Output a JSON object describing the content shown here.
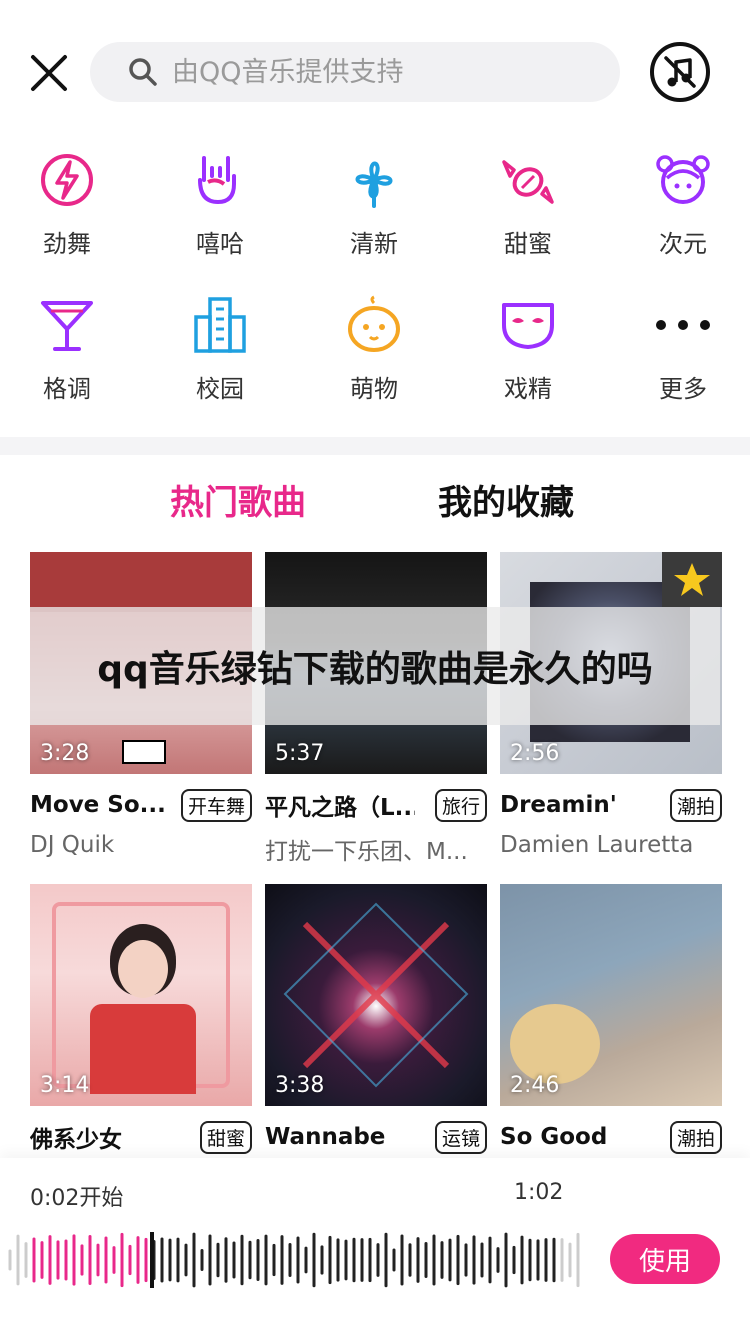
{
  "search": {
    "placeholder": "由QQ音乐提供支持"
  },
  "categories": [
    {
      "label": "劲舞",
      "icon": "lightning-icon"
    },
    {
      "label": "嘻哈",
      "icon": "rock-hand-icon"
    },
    {
      "label": "清新",
      "icon": "clover-icon"
    },
    {
      "label": "甜蜜",
      "icon": "candy-icon"
    },
    {
      "label": "次元",
      "icon": "anime-girl-icon"
    },
    {
      "label": "格调",
      "icon": "cocktail-icon"
    },
    {
      "label": "校园",
      "icon": "school-building-icon"
    },
    {
      "label": "萌物",
      "icon": "cute-face-icon"
    },
    {
      "label": "戏精",
      "icon": "mask-icon"
    },
    {
      "label": "更多",
      "icon": "more-dots-icon"
    }
  ],
  "tabs": {
    "hot": "热门歌曲",
    "favorites": "我的收藏"
  },
  "banner": {
    "text": "qq音乐绿钻下载的歌曲是永久的吗"
  },
  "songs": [
    {
      "title": "Move So...",
      "tag": "开车舞",
      "artist": "DJ Quik",
      "duration": "3:28"
    },
    {
      "title": "平凡之路（L...",
      "tag": "旅行",
      "artist": "打扰一下乐团、M...",
      "duration": "5:37"
    },
    {
      "title": "Dreamin'",
      "tag": "潮拍",
      "artist": "Damien Lauretta",
      "duration": "2:56"
    },
    {
      "title": "佛系少女",
      "tag": "甜蜜",
      "artist": "",
      "duration": "3:14"
    },
    {
      "title": "Wannabe",
      "tag": "运镜",
      "artist": "",
      "duration": "3:38"
    },
    {
      "title": "So Good",
      "tag": "潮拍",
      "artist": "",
      "duration": "2:46"
    }
  ],
  "player": {
    "start_label": "0:02开始",
    "end_time": "1:02",
    "use_label": "使用"
  },
  "colors": {
    "accent": "#e8288a",
    "purple": "#8a2be2",
    "blue": "#1fa0e0",
    "orange": "#f5a623"
  }
}
